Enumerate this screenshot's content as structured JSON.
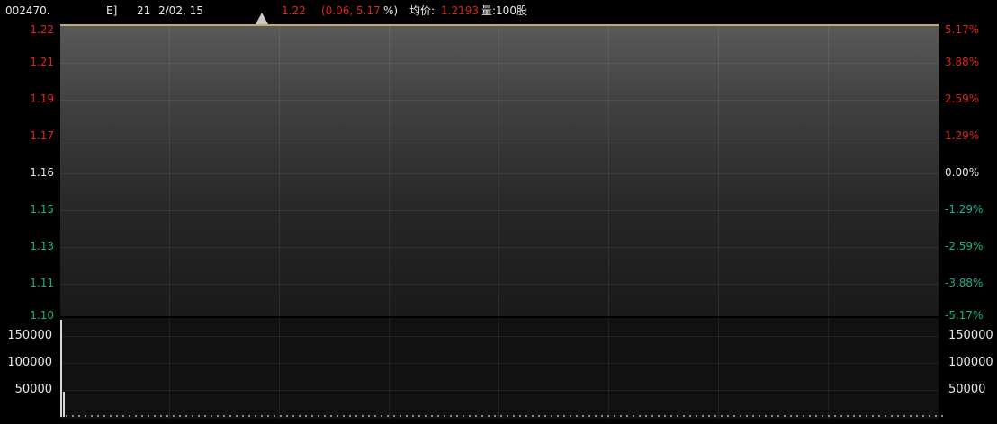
{
  "header": {
    "code": "002470.",
    "type_fragment": "E]",
    "date": "21",
    "date2": "2/02, 15",
    "price": "1.22",
    "change": "(0.06,",
    "change_pct": "5.17",
    "change_pct_unit": "%)",
    "avg_label": "均价:",
    "avg_value": "1.2193",
    "vol_label": "量:100股"
  },
  "price_axis": {
    "left": [
      {
        "text": "1.22",
        "color": "red"
      },
      {
        "text": "1.21",
        "color": "red"
      },
      {
        "text": "1.19",
        "color": "red"
      },
      {
        "text": "1.17",
        "color": "red"
      },
      {
        "text": "1.16",
        "color": "white"
      },
      {
        "text": "1.15",
        "color": "green"
      },
      {
        "text": "1.13",
        "color": "green"
      },
      {
        "text": "1.11",
        "color": "green"
      },
      {
        "text": "1.10",
        "color": "green"
      }
    ],
    "right": [
      {
        "text": "5.17%",
        "color": "red"
      },
      {
        "text": "3.88%",
        "color": "red"
      },
      {
        "text": "2.59%",
        "color": "red"
      },
      {
        "text": "1.29%",
        "color": "red"
      },
      {
        "text": "0.00%",
        "color": "white"
      },
      {
        "text": "-1.29%",
        "color": "green"
      },
      {
        "text": "-2.59%",
        "color": "green"
      },
      {
        "text": "-3.88%",
        "color": "green"
      },
      {
        "text": "-5.17%",
        "color": "green"
      }
    ]
  },
  "volume_axis": {
    "left": [
      "150000",
      "100000",
      "50000"
    ],
    "right": [
      "150000",
      "100000",
      "50000"
    ]
  },
  "colors": {
    "up": "#e0241b",
    "flat": "#e8e8e8",
    "down": "#19b08a",
    "price_line": "#c9a96a"
  }
}
